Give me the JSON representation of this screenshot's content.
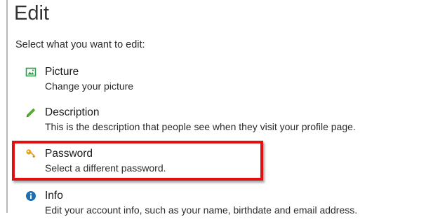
{
  "page": {
    "title": "Edit",
    "subtitle": "Select what you want to edit:"
  },
  "options": [
    {
      "label": "Picture",
      "description": "Change your picture",
      "icon": "picture-icon",
      "icon_color": "#2e9d4a"
    },
    {
      "label": "Description",
      "description": "This is the description that people see when they visit your profile page.",
      "icon": "pencil-icon",
      "icon_color": "#5aa832"
    },
    {
      "label": "Password",
      "description": "Select a different password.",
      "icon": "key-icon",
      "icon_color": "#e3a21a"
    },
    {
      "label": "Info",
      "description": "Edit your account info, such as your name, birthdate and email address.",
      "icon": "info-icon",
      "icon_color": "#1f6fb3"
    }
  ],
  "annotation": {
    "highlight_color": "#e01010",
    "highlighted_option": "Password"
  }
}
